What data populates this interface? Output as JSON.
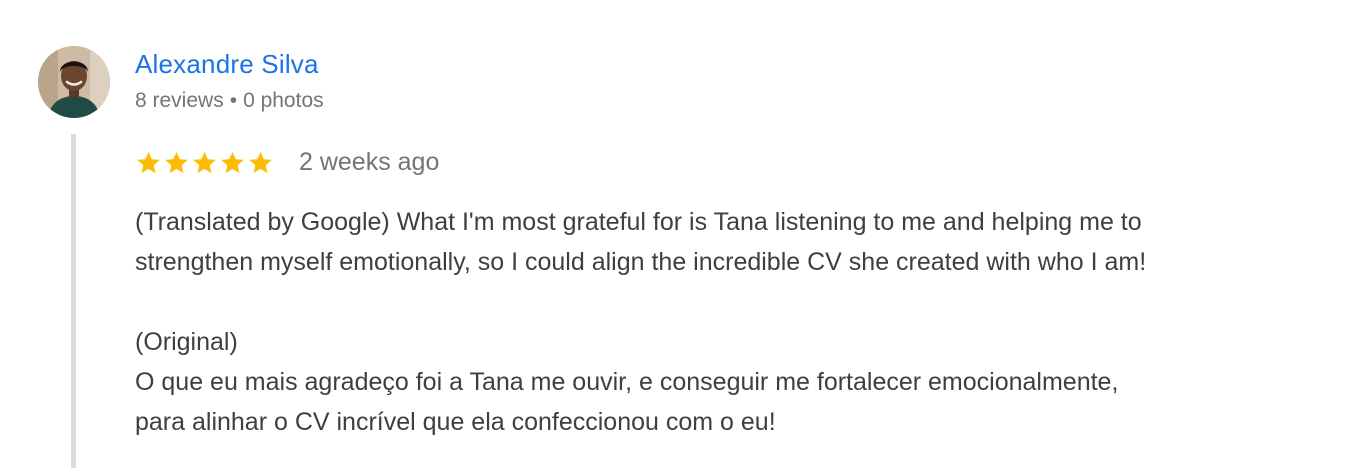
{
  "reviewer": {
    "name": "Alexandre Silva",
    "reviews": "8 reviews",
    "separator": "•",
    "photos": "0 photos"
  },
  "review": {
    "rating": 5,
    "rating_max": 5,
    "star_color": "#fbbc04",
    "date": "2 weeks ago",
    "translated_line1": "(Translated by Google) What I'm most grateful for is Tana listening to me and helping me to",
    "translated_line2": "strengthen myself emotionally, so I could align the incredible CV she created with who I am!",
    "original_label": "(Original)",
    "original_line1": "O que eu mais agradeço foi a Tana me ouvir, e conseguir me fortalecer emocionalmente,",
    "original_line2": "para alinhar o CV incrível que ela confeccionou com o eu!"
  },
  "colors": {
    "name_link": "#1a73e8",
    "meta_text": "#70757a",
    "body_text": "#3c4043",
    "thread_line": "#dadce0"
  }
}
